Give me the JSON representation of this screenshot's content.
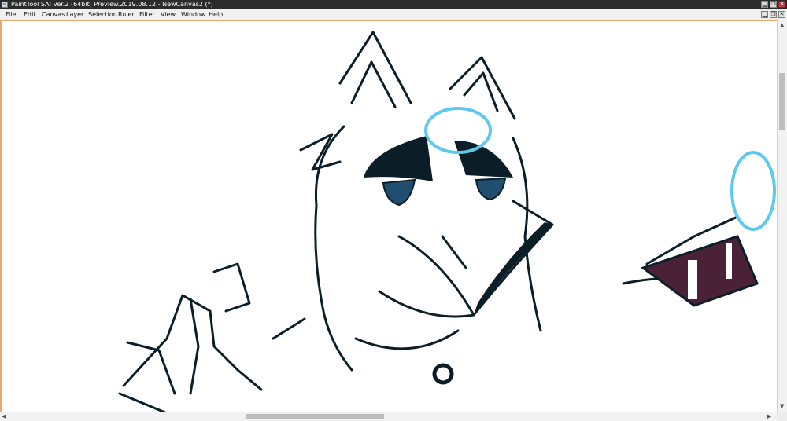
{
  "window": {
    "title": "PaintTool SAI Ver.2 (64bit) Preview.2019.08.12 - NewCanvas2 (*)",
    "buttons": [
      {
        "name": "minimize",
        "glyph": "▁"
      },
      {
        "name": "restore",
        "glyph": "❐"
      },
      {
        "name": "close",
        "glyph": "✕"
      }
    ]
  },
  "menu": {
    "items": [
      "File",
      "Edit",
      "Canvas",
      "Layer",
      "Selection",
      "Ruler",
      "Filter",
      "View",
      "Window",
      "Help"
    ]
  },
  "document_buttons": [
    {
      "name": "minimize",
      "glyph": "▁"
    },
    {
      "name": "restore",
      "glyph": "❐"
    },
    {
      "name": "close",
      "glyph": "✕"
    }
  ],
  "colors": {
    "ink": "#0b1e28",
    "halo": "#5ec9ef",
    "eye": "#1f4e6e",
    "mouth": "#4a2137",
    "canvas_border": "#e9a86b"
  },
  "scrollbars": {
    "arrows": {
      "up": "▲",
      "down": "▼",
      "left": "◀",
      "right": "▶"
    }
  }
}
